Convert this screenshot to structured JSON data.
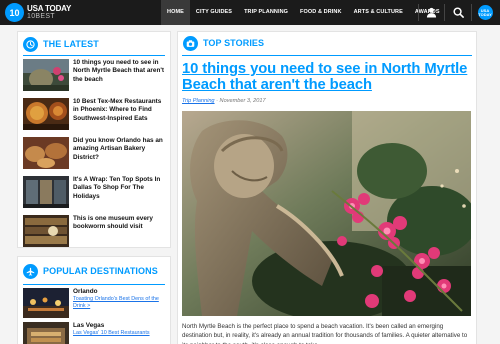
{
  "header": {
    "logo_mark": "10",
    "logo_line1": "USA TODAY",
    "logo_line2": "10BEST",
    "nav": [
      "HOME",
      "CITY GUIDES",
      "TRIP PLANNING",
      "FOOD & DRINK",
      "ARTS & CULTURE",
      "AWARDS"
    ],
    "badge_line1": "USA",
    "badge_line2": "TODAY"
  },
  "latest": {
    "title": "THE LATEST",
    "items": [
      {
        "title": "10 things you need to see in North Myrtle Beach that aren't the beach"
      },
      {
        "title": "10 Best Tex-Mex Restaurants in Phoenix: Where to Find Southwest-Inspired Eats"
      },
      {
        "title": "Did you know Orlando has an amazing Artisan Bakery District?"
      },
      {
        "title": "It's A Wrap: Ten Top Spots In Dallas To Shop For The Holidays"
      },
      {
        "title": "This is one museum every bookworm should visit"
      }
    ]
  },
  "destinations": {
    "title": "POPULAR DESTINATIONS",
    "items": [
      {
        "city": "Orlando",
        "link": "Toasting Orlando's Best Dens of the Drink >"
      },
      {
        "city": "Las Vegas",
        "link": "Las Vegas' 10 Best Restaurants"
      }
    ]
  },
  "top_stories": {
    "title": "TOP STORIES",
    "headline": "10 things you need to see in North Myrtle Beach that aren't the beach",
    "category": "Trip Planning",
    "date": "November 3, 2017",
    "byline_sep": " · ",
    "body": "North Myrtle Beach is the perfect place to spend a beach vacation. It's been called an emerging destination but, in reality, it's already an annual tradition for thousands of families.   A quieter alternative to its neighbor to the south, it's close enough to take"
  },
  "colors": {
    "accent": "#009bff",
    "header_bg": "#1b1b1b",
    "link": "#1a73e8"
  },
  "icons": [
    "user-icon",
    "search-icon",
    "clock-icon",
    "camera-icon",
    "plane-icon"
  ]
}
